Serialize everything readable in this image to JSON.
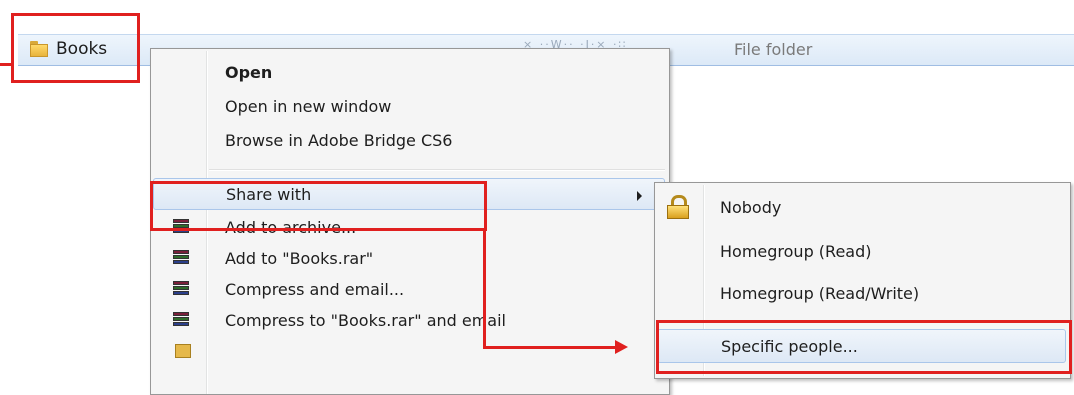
{
  "explorer_row": {
    "folder_name": "Books",
    "faded_text": "× ··W··  ·I·×    ·∷",
    "type": "File folder"
  },
  "context_menu": {
    "items": [
      {
        "label": "Open",
        "bold": true
      },
      {
        "label": "Open in new window"
      },
      {
        "label": "Browse in Adobe Bridge CS6"
      },
      {
        "label": "Share with",
        "has_submenu": true
      },
      {
        "label": "Add to archive...",
        "icon": "winrar-icon"
      },
      {
        "label": "Add to \"Books.rar\"",
        "icon": "winrar-icon"
      },
      {
        "label": "Compress and email...",
        "icon": "winrar-icon"
      },
      {
        "label": "Compress to \"Books.rar\" and email",
        "icon": "winrar-icon"
      }
    ]
  },
  "share_submenu": {
    "items": [
      {
        "label": "Nobody",
        "icon": "lock-icon"
      },
      {
        "label": "Homegroup (Read)"
      },
      {
        "label": "Homegroup (Read/Write)"
      },
      {
        "label": "Specific people..."
      }
    ]
  },
  "colors": {
    "annotation": "#e0201f",
    "hover_border": "#aac6ea",
    "menu_background": "#f5f5f5"
  }
}
